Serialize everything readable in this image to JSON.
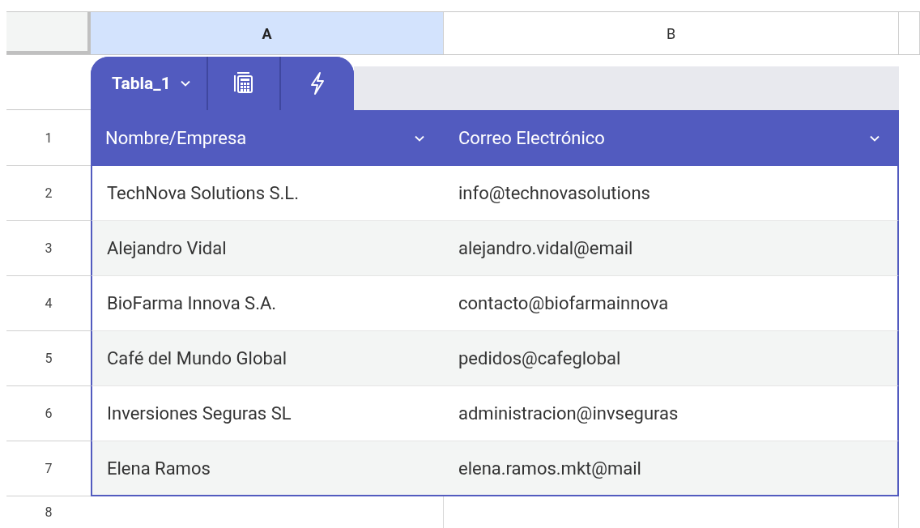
{
  "column_headers": [
    {
      "label": "A",
      "selected": true
    },
    {
      "label": "B",
      "selected": false
    }
  ],
  "table": {
    "name": "Tabla_1",
    "columns": [
      {
        "label": "Nombre/Empresa"
      },
      {
        "label": "Correo Electrónico"
      }
    ],
    "header_row_number": "1",
    "rows": [
      {
        "number": "2",
        "cells": [
          "TechNova Solutions S.L.",
          "info@technovasolutions"
        ]
      },
      {
        "number": "3",
        "cells": [
          "Alejandro Vidal",
          "alejandro.vidal@email"
        ]
      },
      {
        "number": "4",
        "cells": [
          "BioFarma Innova S.A.",
          "contacto@biofarmainnova"
        ]
      },
      {
        "number": "5",
        "cells": [
          "Café del Mundo Global",
          "pedidos@cafeglobal"
        ]
      },
      {
        "number": "6",
        "cells": [
          "Inversiones Seguras SL",
          "administracion@invseguras"
        ]
      },
      {
        "number": "7",
        "cells": [
          "Elena Ramos",
          "elena.ramos.mkt@mail"
        ]
      }
    ]
  },
  "empty_rows": [
    {
      "number": "8"
    }
  ]
}
